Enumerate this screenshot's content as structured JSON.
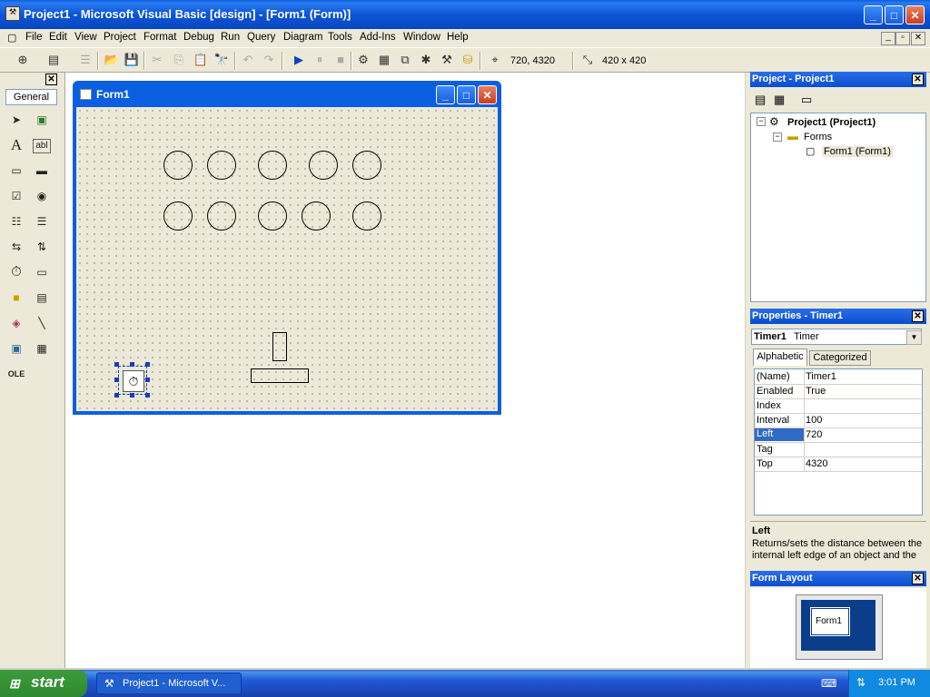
{
  "window": {
    "title": "Project1 - Microsoft Visual Basic [design] - [Form1 (Form)]",
    "minimize": "_",
    "maximize": "□",
    "close": "✕",
    "mdi_controls": [
      "_",
      "▫",
      "✕"
    ]
  },
  "menu": [
    "File",
    "Edit",
    "View",
    "Project",
    "Format",
    "Debug",
    "Run",
    "Query",
    "Diagram",
    "Tools",
    "Add-Ins",
    "Window",
    "Help"
  ],
  "toolbar": {
    "position": "720, 4320",
    "size": "420 x 420"
  },
  "toolbox": {
    "tab_label": "General",
    "close": "✕",
    "tools": [
      "pointer-icon",
      "picturebox-icon",
      "label-icon",
      "textbox-icon",
      "frame-icon",
      "commandbutton-icon",
      "checkbox-icon",
      "optionbutton-icon",
      "combobox-icon",
      "listbox-icon",
      "hscrollbar-icon",
      "vscrollbar-icon",
      "timer-icon",
      "drivelistbox-icon",
      "dirlistbox-icon",
      "filelistbox-icon",
      "shape-icon",
      "line-icon",
      "image-icon",
      "data-icon",
      "ole-icon"
    ]
  },
  "form": {
    "title": "Form1",
    "shapes": {
      "circles_row1": 5,
      "circles_row2": 5
    }
  },
  "project_explorer": {
    "header": "Project - Project1",
    "root": "Project1 (Project1)",
    "folder": "Forms",
    "item": "Form1 (Form1)"
  },
  "properties": {
    "header": "Properties - Timer1",
    "object_name": "Timer1",
    "object_type": "Timer",
    "tabs": [
      "Alphabetic",
      "Categorized"
    ],
    "rows": [
      {
        "name": "(Name)",
        "value": "Timer1"
      },
      {
        "name": "Enabled",
        "value": "True"
      },
      {
        "name": "Index",
        "value": ""
      },
      {
        "name": "Interval",
        "value": "100"
      },
      {
        "name": "Left",
        "value": "720"
      },
      {
        "name": "Tag",
        "value": ""
      },
      {
        "name": "Top",
        "value": "4320"
      }
    ],
    "selected_row": "Left",
    "description_title": "Left",
    "description_text": "Returns/sets the distance between the internal left edge of an object and the"
  },
  "form_layout": {
    "header": "Form Layout",
    "preview_label": "Form1"
  },
  "taskbar": {
    "start": "start",
    "task": "Project1 - Microsoft V...",
    "clock": "3:01 PM"
  }
}
